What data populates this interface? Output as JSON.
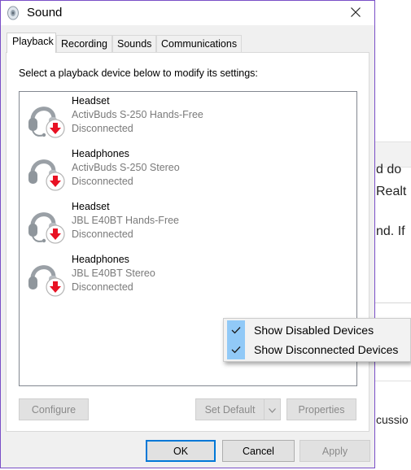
{
  "window": {
    "title": "Sound"
  },
  "tabs": [
    {
      "label": "Playback",
      "active": true
    },
    {
      "label": "Recording"
    },
    {
      "label": "Sounds"
    },
    {
      "label": "Communications"
    }
  ],
  "playback": {
    "instruction": "Select a playback device below to modify its settings:",
    "devices": [
      {
        "name": "Headset",
        "description": "ActivBuds S-250 Hands-Free",
        "status": "Disconnected",
        "icon": "headset-disconnected-icon"
      },
      {
        "name": "Headphones",
        "description": "ActivBuds S-250 Stereo",
        "status": "Disconnected",
        "icon": "headphones-disconnected-icon"
      },
      {
        "name": "Headset",
        "description": "JBL E40BT Hands-Free",
        "status": "Disconnected",
        "icon": "headset-disconnected-icon"
      },
      {
        "name": "Headphones",
        "description": "JBL E40BT Stereo",
        "status": "Disconnected",
        "icon": "headphones-disconnected-icon"
      }
    ],
    "buttons": {
      "configure": "Configure",
      "set_default": "Set Default",
      "properties": "Properties"
    }
  },
  "context_menu": {
    "items": [
      {
        "label": "Show Disabled Devices",
        "checked": true
      },
      {
        "label": "Show Disconnected Devices",
        "checked": true
      }
    ]
  },
  "footer": {
    "ok": "OK",
    "cancel": "Cancel",
    "apply": "Apply"
  },
  "background_document": {
    "fragments": [
      "d do",
      "Realt",
      "nd. If",
      "cussio"
    ]
  },
  "colors": {
    "window_border": "#7a4fc7",
    "menu_check_bg": "#91c9f7",
    "status_arrow": "#e81123",
    "focus_blue": "#0078d7"
  }
}
